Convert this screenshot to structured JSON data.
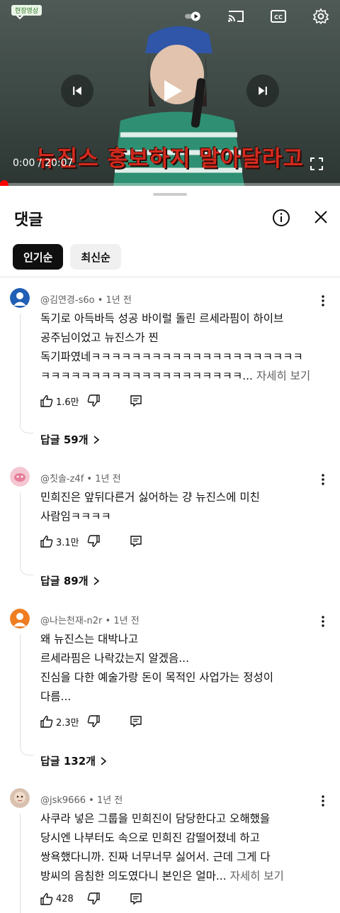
{
  "video": {
    "live_badge": "현장영상",
    "caption": "뉴진스 홍보하지 말아달라고",
    "time": "0:00 / 20:07",
    "progress": 0.0,
    "icons": [
      "chevron-down-icon",
      "play-toggle-icon",
      "cast-icon",
      "closed-captions-icon",
      "settings-gear-icon",
      "previous-icon",
      "play-icon",
      "next-icon",
      "fullscreen-icon"
    ]
  },
  "comments_panel": {
    "title": "댓글",
    "chips": [
      "인기순",
      "최신순"
    ],
    "active_chip": "인기순",
    "comments": [
      {
        "author": "@김연경-s6o",
        "age": "1년 전",
        "lines": [
          "독기로 아득바득 성공 바이럴 돌린 르세라핌이 하이브",
          "공주님이었고 뉴진스가 찐",
          "독기파였네ㅋㅋㅋㅋㅋㅋㅋㅋㅋㅋㅋㅋㅋㅋㅋㅋㅋㅋㅋㅋㅋ",
          "ㅋㅋㅋㅋㅋㅋㅋㅋㅋㅋㅋㅋㅋㅋㅋㅋㅋㅋㅋㅋ..."
        ],
        "more": "자세히 보기",
        "likes": "1.6만",
        "replies": "답글 59개",
        "avatar_color": "#1f5fb5"
      },
      {
        "author": "@칫솔-z4f",
        "age": "1년 전",
        "lines": [
          "민희진은 앞뒤다른거 싫어하는 걍 뉴진스에 미친",
          "사람임ㅋㅋㅋㅋ"
        ],
        "more": "",
        "likes": "3.1만",
        "replies": "답글 89개",
        "avatar_color": "#f2b4c3"
      },
      {
        "author": "@나는천재-n2r",
        "age": "1년 전",
        "lines": [
          "왜 뉴진스는 대박나고",
          "르세라핌은 나락갔는지 알겠음...",
          "진심을 다한 예술가랑 돈이 목적인 사업가는 정성이",
          "다름..."
        ],
        "more": "",
        "likes": "2.3만",
        "replies": "답글 132개",
        "avatar_color": "#ef7d22"
      },
      {
        "author": "@jsk9666",
        "age": "1년 전",
        "lines": [
          "사쿠라 넣은 그룹을 민희진이 담당한다고 오해했을",
          "당시엔 나부터도 속으로 민희진 감떨어졌네 하고",
          "쌍욕했다니까. 진짜 너무너무 싫어서. 근데 그게 다",
          "방씨의 음침한 의도였다니 본인은 얼마..."
        ],
        "more": "자세히 보기",
        "likes": "428",
        "replies": "",
        "avatar_color": "#c9a892"
      }
    ]
  }
}
